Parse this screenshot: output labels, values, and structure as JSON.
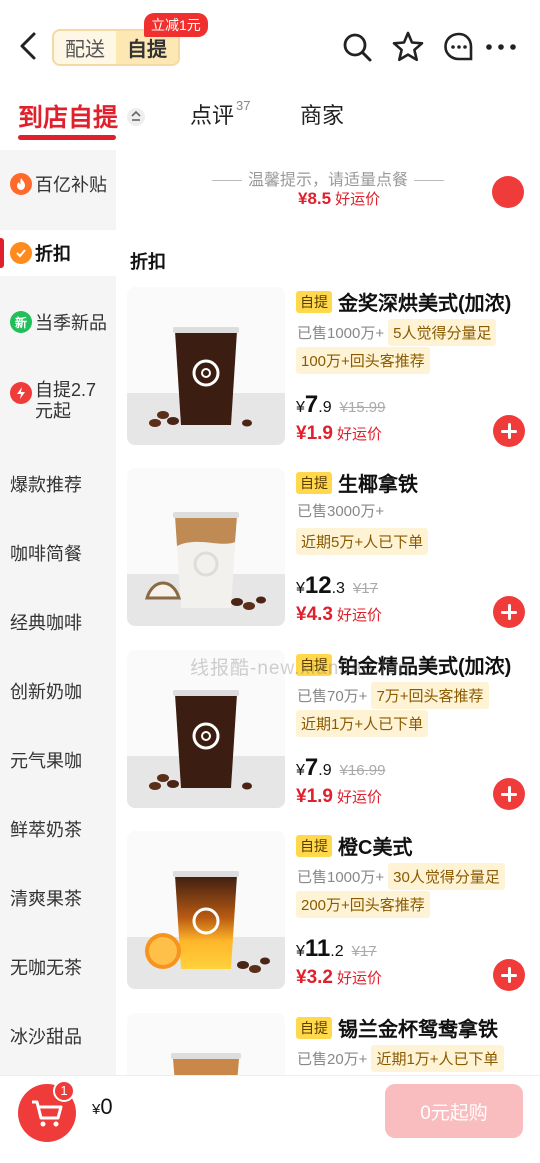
{
  "header": {
    "mode_delivery": "配送",
    "mode_pickup": "自提",
    "promo_tag": "立减1元",
    "icons": [
      "back-arrow-icon",
      "search-icon",
      "star-icon",
      "chat-icon",
      "more-icon"
    ]
  },
  "tabs": {
    "pickup": "到店自提",
    "reviews": "点评",
    "reviews_count": "37",
    "shop": "商家"
  },
  "sidebar": {
    "items": [
      {
        "label": "百亿补贴",
        "icon": "fire-icon"
      },
      {
        "label": "折扣",
        "icon": "discount-icon"
      },
      {
        "label": "当季新品",
        "icon": "new-icon",
        "icon_text": "新"
      },
      {
        "label": "自提2.7元起",
        "icon": "bolt-icon"
      },
      {
        "label": "爆款推荐"
      },
      {
        "label": "咖啡简餐"
      },
      {
        "label": "经典咖啡"
      },
      {
        "label": "创新奶咖"
      },
      {
        "label": "元气果咖"
      },
      {
        "label": "鲜萃奶茶"
      },
      {
        "label": "清爽果茶"
      },
      {
        "label": "无咖无茶"
      },
      {
        "label": "冰沙甜品"
      }
    ],
    "active_index": 1
  },
  "content": {
    "tip": "温馨提示，请适量点餐",
    "prev_price": "¥8.5",
    "prev_price_label": "好运价",
    "section_title": "折扣"
  },
  "products": [
    {
      "tag": "自提",
      "name": "金奖深烘美式(加浓)",
      "sold": "已售1000万+",
      "badge1": "5人觉得分量足",
      "badge2": "100万+回头客推荐",
      "yen": "¥",
      "price_int": "7",
      "price_dec": ".9",
      "original": "¥15.99",
      "deal": "¥1.9",
      "deal_label": "好运价",
      "drink": "black"
    },
    {
      "tag": "自提",
      "name": "生椰拿铁",
      "sold": "已售3000万+",
      "badge1": "",
      "badge2": "近期5万+人已下单",
      "yen": "¥",
      "price_int": "12",
      "price_dec": ".3",
      "original": "¥17",
      "deal": "¥4.3",
      "deal_label": "好运价",
      "drink": "latte"
    },
    {
      "tag": "自提",
      "name": "铂金精品美式(加浓)",
      "sold": "已售70万+",
      "badge1": "7万+回头客推荐",
      "badge2": "近期1万+人已下单",
      "yen": "¥",
      "price_int": "7",
      "price_dec": ".9",
      "original": "¥16.99",
      "deal": "¥1.9",
      "deal_label": "好运价",
      "drink": "black"
    },
    {
      "tag": "自提",
      "name": "橙C美式",
      "sold": "已售1000万+",
      "badge1": "30人觉得分量足",
      "badge2": "200万+回头客推荐",
      "yen": "¥",
      "price_int": "11",
      "price_dec": ".2",
      "original": "¥17",
      "deal": "¥3.2",
      "deal_label": "好运价",
      "drink": "orange"
    },
    {
      "tag": "自提",
      "name": "锡兰金杯鸳鸯拿铁",
      "sold": "已售20万+",
      "badge1": "近期1万+人已下单",
      "badge2": "",
      "drink": "partial"
    }
  ],
  "watermark": "线报酷-new.xianbao.fun",
  "cart": {
    "count": "1",
    "total_yen": "¥",
    "total": "0",
    "checkout": "0元起购"
  }
}
